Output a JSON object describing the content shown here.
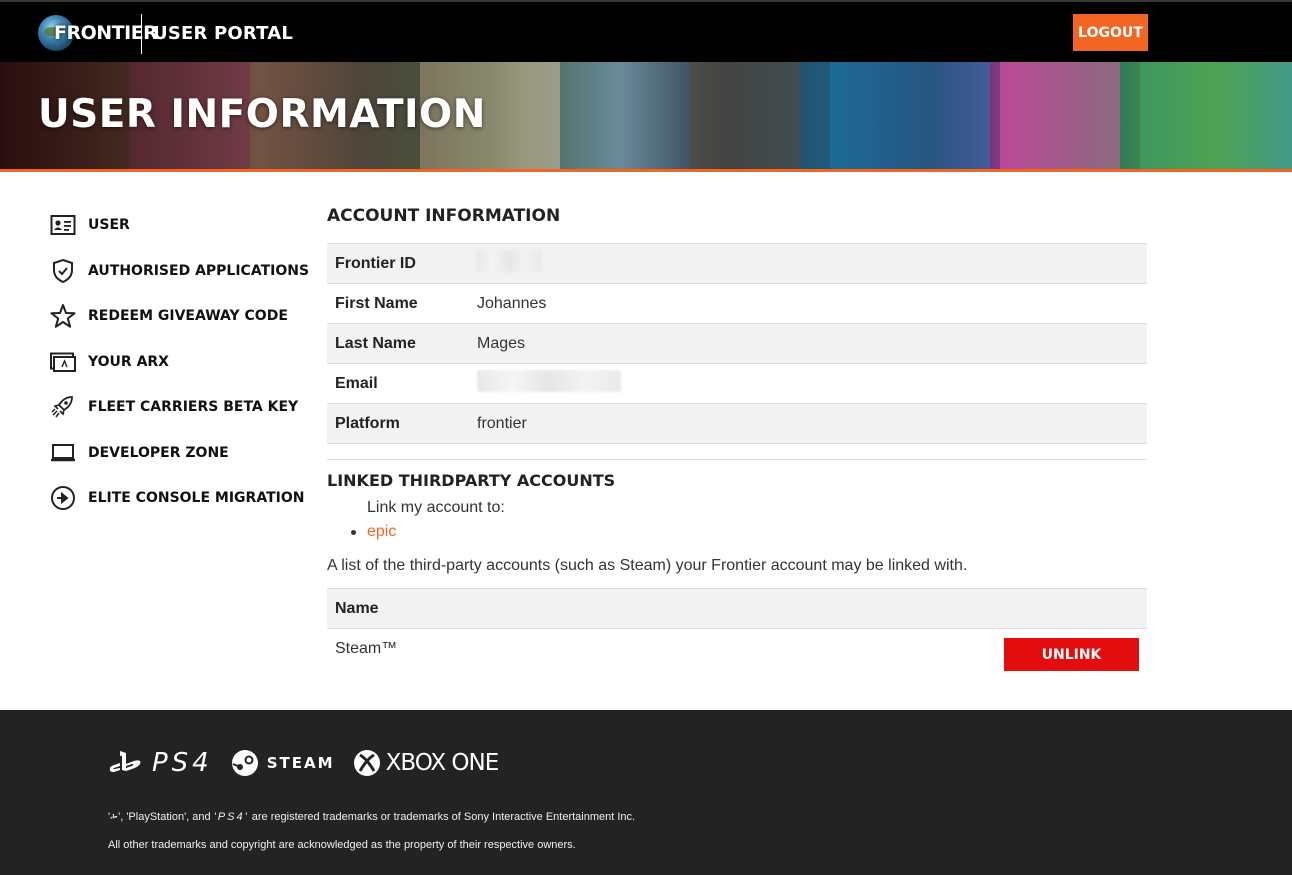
{
  "header": {
    "logo_text": "FRONTIER",
    "portal_title": "USER PORTAL",
    "logout_label": "LOGOUT"
  },
  "banner": {
    "title": "USER INFORMATION"
  },
  "sidebar": {
    "items": [
      {
        "label": "USER",
        "icon": "id-card-icon"
      },
      {
        "label": "AUTHORISED APPLICATIONS",
        "icon": "shield-check-icon"
      },
      {
        "label": "REDEEM GIVEAWAY CODE",
        "icon": "star-icon"
      },
      {
        "label": "YOUR ARX",
        "icon": "arx-card-icon"
      },
      {
        "label": "FLEET CARRIERS BETA KEY",
        "icon": "rocket-icon"
      },
      {
        "label": "DEVELOPER ZONE",
        "icon": "laptop-icon"
      },
      {
        "label": "ELITE CONSOLE MIGRATION",
        "icon": "arrow-circle-icon"
      }
    ]
  },
  "account": {
    "heading": "ACCOUNT INFORMATION",
    "rows": [
      {
        "label": "Frontier ID",
        "value": ""
      },
      {
        "label": "First Name",
        "value": "Johannes"
      },
      {
        "label": "Last Name",
        "value": "Mages"
      },
      {
        "label": "Email",
        "value": ""
      },
      {
        "label": "Platform",
        "value": "frontier"
      }
    ]
  },
  "linked": {
    "heading": "LINKED THIRDPARTY ACCOUNTS",
    "intro": "Link my account to:",
    "options": [
      "epic"
    ],
    "description": "A list of the third-party accounts (such as Steam) your Frontier account may be linked with.",
    "table_header": "Name",
    "accounts": [
      {
        "name": "Steam™",
        "action": "UNLINK"
      }
    ]
  },
  "footer": {
    "platforms": [
      "PS4",
      "STEAM",
      "XBOX ONE"
    ],
    "note1_suffix": "are registered trademarks or trademarks of Sony Interactive Entertainment Inc.",
    "note1_middle": "'PlayStation', and",
    "note2": "All other trademarks and copyright are acknowledged as the property of their respective owners."
  },
  "colors": {
    "accent": "#f26522",
    "danger": "#e30d0d",
    "footer_bg": "#232323"
  }
}
